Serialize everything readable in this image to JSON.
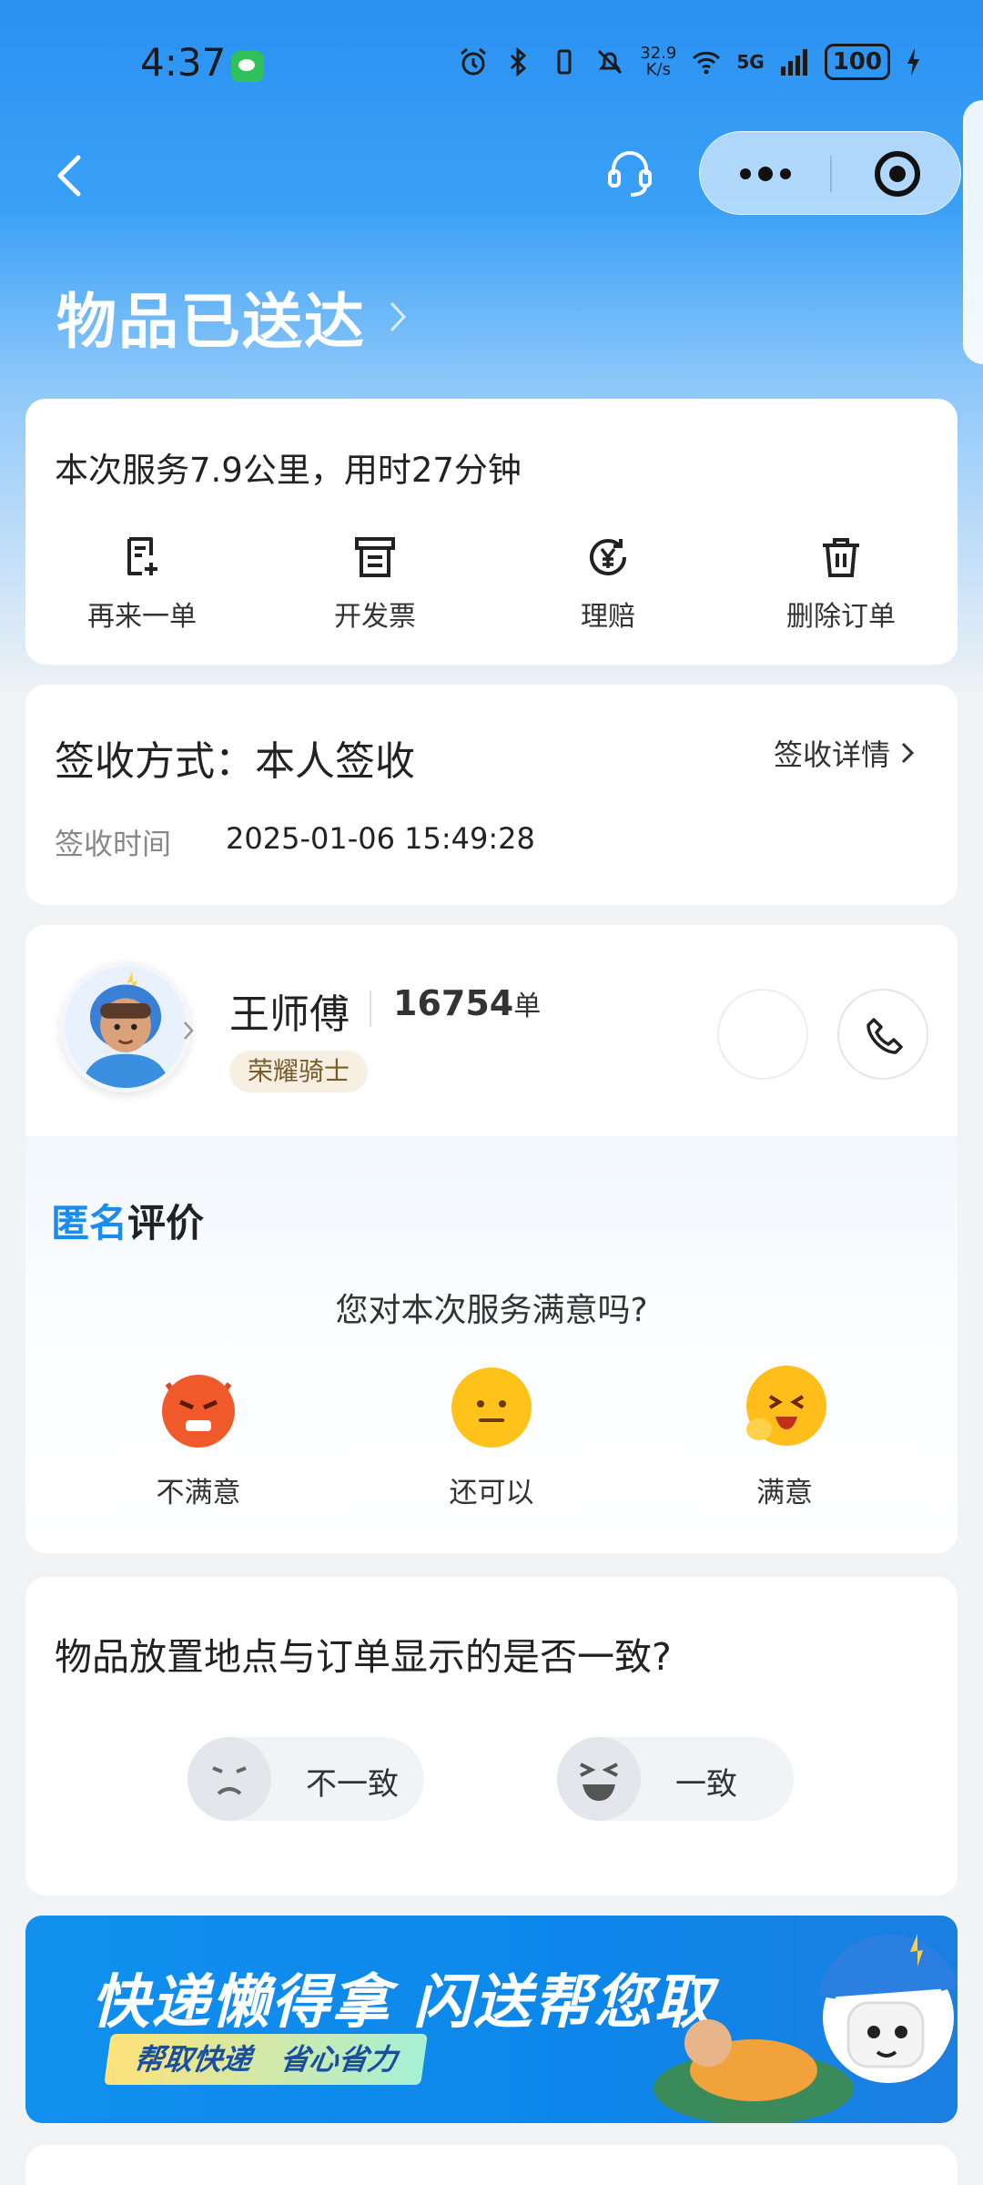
{
  "status_bar": {
    "time": "4:37",
    "net_speed_top": "32.9",
    "net_speed_bottom": "K/s",
    "network": "5G",
    "battery": "100"
  },
  "header": {
    "title": "物品已送达"
  },
  "service": {
    "summary": "本次服务7.9公里，用时27分钟",
    "actions": [
      {
        "label": "再来一单",
        "icon": "reorder-icon"
      },
      {
        "label": "开发票",
        "icon": "invoice-icon"
      },
      {
        "label": "理赔",
        "icon": "claim-icon"
      },
      {
        "label": "删除订单",
        "icon": "trash-icon"
      }
    ]
  },
  "signature": {
    "method": "签收方式：本人签收",
    "detail_link": "签收详情",
    "time_label": "签收时间",
    "time_value": "2025-01-06 15:49:28"
  },
  "rider": {
    "name": "王师傅",
    "orders": "16754",
    "orders_unit": "单",
    "badge": "荣耀骑士"
  },
  "review": {
    "title_highlight": "匿名",
    "title_rest": "评价",
    "question": "您对本次服务满意吗?",
    "options": [
      {
        "label": "不满意",
        "icon": "angry-face-icon"
      },
      {
        "label": "还可以",
        "icon": "neutral-face-icon"
      },
      {
        "label": "满意",
        "icon": "happy-face-icon"
      }
    ]
  },
  "placement": {
    "question": "物品放置地点与订单显示的是否一致?",
    "options": [
      {
        "label": "不一致",
        "icon": "frown-face-icon"
      },
      {
        "label": "一致",
        "icon": "laugh-face-icon"
      }
    ]
  },
  "banner": {
    "headline": "快递懒得拿 闪送帮您取",
    "subline": "帮取快递　省心省力"
  },
  "colors": {
    "brand_blue": "#2b91f2",
    "highlight_blue": "#1a8cf0"
  }
}
